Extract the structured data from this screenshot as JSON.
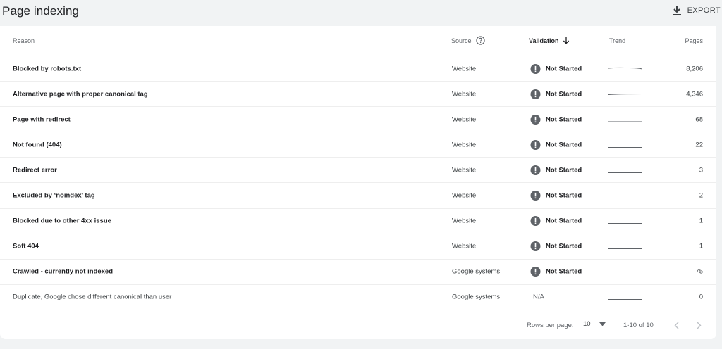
{
  "header": {
    "title": "Page indexing",
    "export_label": "EXPORT"
  },
  "table": {
    "columns": {
      "reason": "Reason",
      "source": "Source",
      "validation": "Validation",
      "trend": "Trend",
      "pages": "Pages"
    },
    "rows": [
      {
        "reason": "Blocked by robots.txt",
        "source": "Website",
        "validation": "Not Started",
        "pages": "8,206"
      },
      {
        "reason": "Alternative page with proper canonical tag",
        "source": "Website",
        "validation": "Not Started",
        "pages": "4,346"
      },
      {
        "reason": "Page with redirect",
        "source": "Website",
        "validation": "Not Started",
        "pages": "68"
      },
      {
        "reason": "Not found (404)",
        "source": "Website",
        "validation": "Not Started",
        "pages": "22"
      },
      {
        "reason": "Redirect error",
        "source": "Website",
        "validation": "Not Started",
        "pages": "3"
      },
      {
        "reason": "Excluded by ‘noindex’ tag",
        "source": "Website",
        "validation": "Not Started",
        "pages": "2"
      },
      {
        "reason": "Blocked due to other 4xx issue",
        "source": "Website",
        "validation": "Not Started",
        "pages": "1"
      },
      {
        "reason": "Soft 404",
        "source": "Website",
        "validation": "Not Started",
        "pages": "1"
      },
      {
        "reason": "Crawled - currently not indexed",
        "source": "Google systems",
        "validation": "Not Started",
        "pages": "75"
      },
      {
        "reason": "Duplicate, Google chose different canonical than user",
        "source": "Google systems",
        "validation": "N/A",
        "pages": "0"
      }
    ]
  },
  "pagination": {
    "rows_per_page_label": "Rows per page:",
    "rows_per_page_value": "10",
    "range": "1-10 of 10"
  },
  "icons": {
    "export": "download-icon",
    "source_help": "help-circle-icon",
    "sort": "arrow-down-icon",
    "status": "alert-circle-icon",
    "select": "caret-down-icon",
    "prev": "chevron-left-icon",
    "next": "chevron-right-icon"
  },
  "colors": {
    "alert_icon": "#5f6368",
    "trend_line": "#5f6368",
    "nav_disabled": "#bdc1c6"
  }
}
